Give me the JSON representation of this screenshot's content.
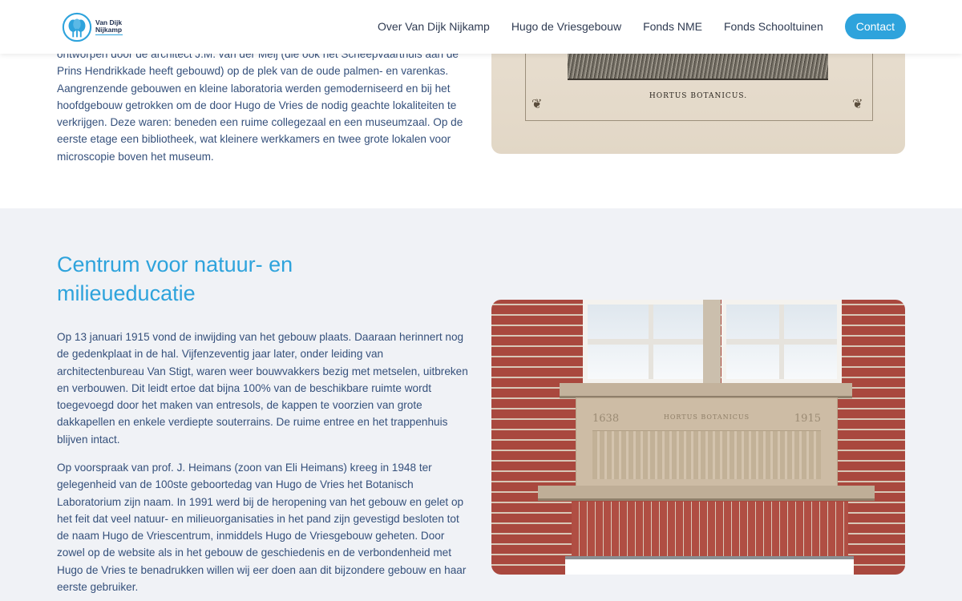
{
  "header": {
    "logo_line1": "Van Dijk",
    "logo_line2": "Nijkamp",
    "nav": [
      {
        "label": "Over Van Dijk Nijkamp"
      },
      {
        "label": "Hugo de Vriesgebouw"
      },
      {
        "label": "Fonds NME"
      },
      {
        "label": "Fonds Schooltuinen"
      }
    ],
    "contact_label": "Contact"
  },
  "top_section": {
    "text": "ontworpen door de architect J.M. van der Meij (die ook het Scheepvaarthuis aan de Prins Hendrikkade heeft gebouwd) op de plek van de oude palmen- en varenkas. Aangrenzende gebouwen en kleine laboratoria werden gemoderniseerd en bij het hoofdgebouw getrokken om de door Hugo de Vries de nodig geachte lokaliteiten te verkrijgen. Deze waren: beneden een ruime collegezaal en een museumzaal. Op de eerste etage een bibliotheek, wat kleinere werkkamers en twee grote lokalen voor microscopie boven het museum.",
    "image_caption": "HORTUS BOTANICUS."
  },
  "main_section": {
    "title": "Centrum voor natuur- en milieueducatie",
    "paragraph1": "Op 13 januari 1915 vond de inwijding van het gebouw plaats. Daaraan herinnert nog de gedenkplaat in de hal. Vijfenzeventig jaar later, onder leiding van architectenbureau Van Stigt, waren weer bouwvakkers bezig met metselen, uitbreken en verbouwen. Dit leidt ertoe dat bijna 100% van de beschikbare ruimte wordt toegevoegd door het maken van entresols, de kappen te voorzien van grote dakkapellen en enkele verdiepte souterrains. De ruime entree en het trappenhuis blijven intact.",
    "paragraph2": "Op voorspraak van prof. J. Heimans (zoon van Eli Heimans) kreeg in 1948 ter gelegenheid van de 100ste geboortedag van Hugo de Vries het Botanisch Laboratorium zijn naam. In 1991 werd bij de heropening van het gebouw en gelet op het feit dat veel natuur- en milieuorganisaties in het pand zijn gevestigd besloten tot de naam Hugo de Vriescentrum, inmiddels Hugo de Vriesgebouw geheten. Door zowel op de website als in het gebouw de geschiedenis en de verbondenheid met Hugo de Vries te benadrukken willen wij eer doen aan dit bijzondere gebouw en haar eerste gebruiker.",
    "facade_year_left": "1638",
    "facade_label": "HORTUS BOTANICUS",
    "facade_year_right": "1915"
  },
  "colors": {
    "accent": "#2ea3dc",
    "text": "#35507b",
    "section_bg": "#f0f2f6"
  }
}
